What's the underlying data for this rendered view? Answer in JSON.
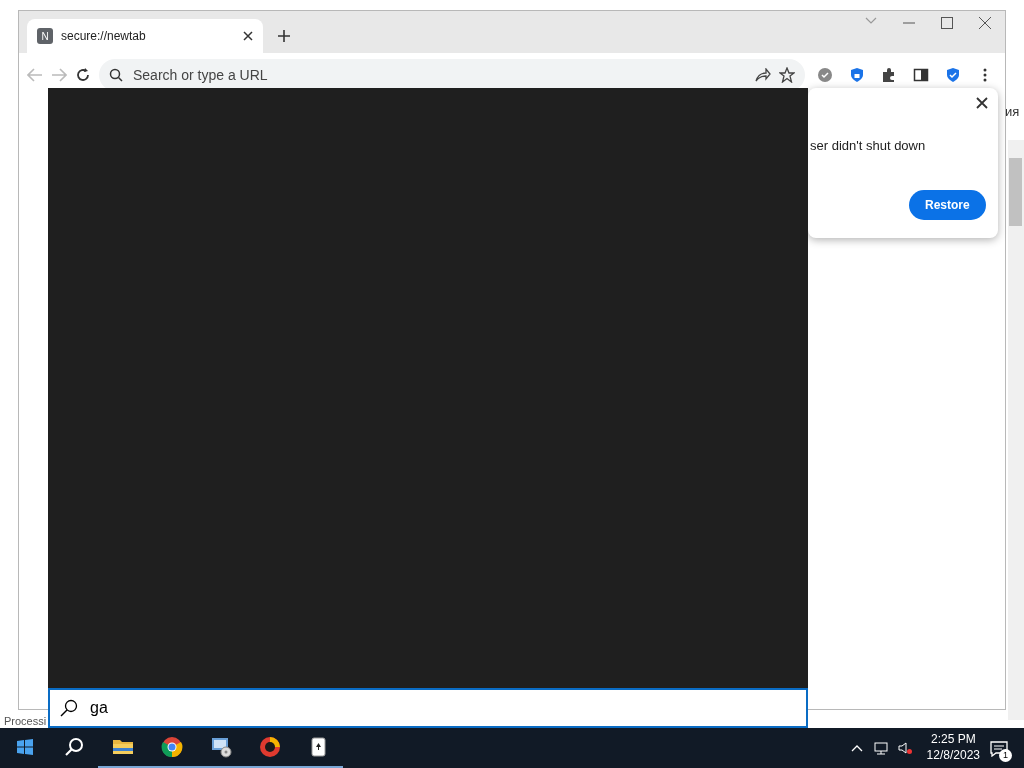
{
  "background_window": {
    "side_text": "ия",
    "status_text": "Processi"
  },
  "browser": {
    "tabs": [
      {
        "favicon": "N",
        "title": "secure://newtab",
        "selected": true
      }
    ],
    "omnibox": {
      "placeholder": "Search or type a URL"
    },
    "restore_bubble": {
      "message": "ser didn't shut down",
      "button": "Restore"
    }
  },
  "start_search": {
    "query": "ga"
  },
  "taskbar": {
    "apps": [
      {
        "kind": "folder",
        "running": true
      },
      {
        "kind": "chrome",
        "running": true
      },
      {
        "kind": "disc",
        "running": true
      },
      {
        "kind": "ring",
        "running": true
      },
      {
        "kind": "cards",
        "running": true
      }
    ],
    "time": "2:25 PM",
    "date": "12/8/2023",
    "notifications": "1"
  }
}
